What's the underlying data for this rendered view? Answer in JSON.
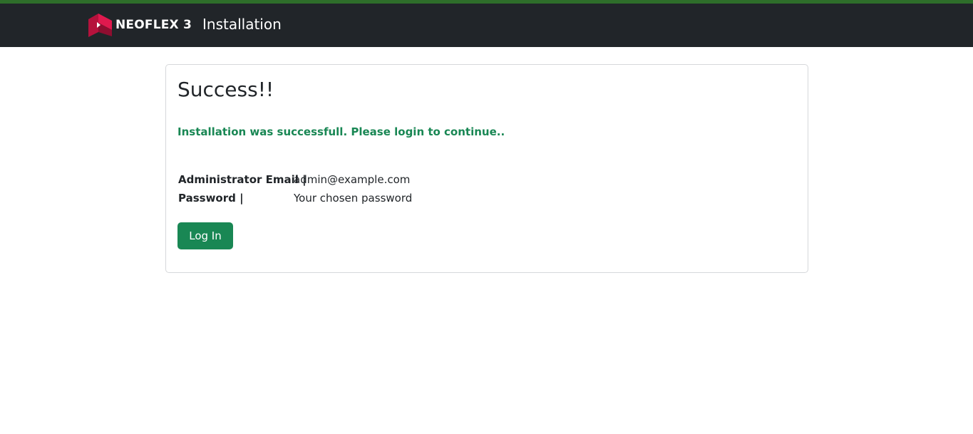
{
  "header": {
    "brand": "NEOFLEX 3",
    "title": "Installation",
    "logo_icon": "neoflex-logo-icon",
    "bar_color": "#212529",
    "accent_color": "#2e6e2a"
  },
  "card": {
    "title": "Success!!",
    "message": "Installation was successfull. Please login to continue..",
    "rows": [
      {
        "label": "Administrator Email |",
        "value": "admin@example.com"
      },
      {
        "label": "Password |",
        "value": "Your chosen password"
      }
    ],
    "login_label": "Log In",
    "success_color": "#198754"
  }
}
